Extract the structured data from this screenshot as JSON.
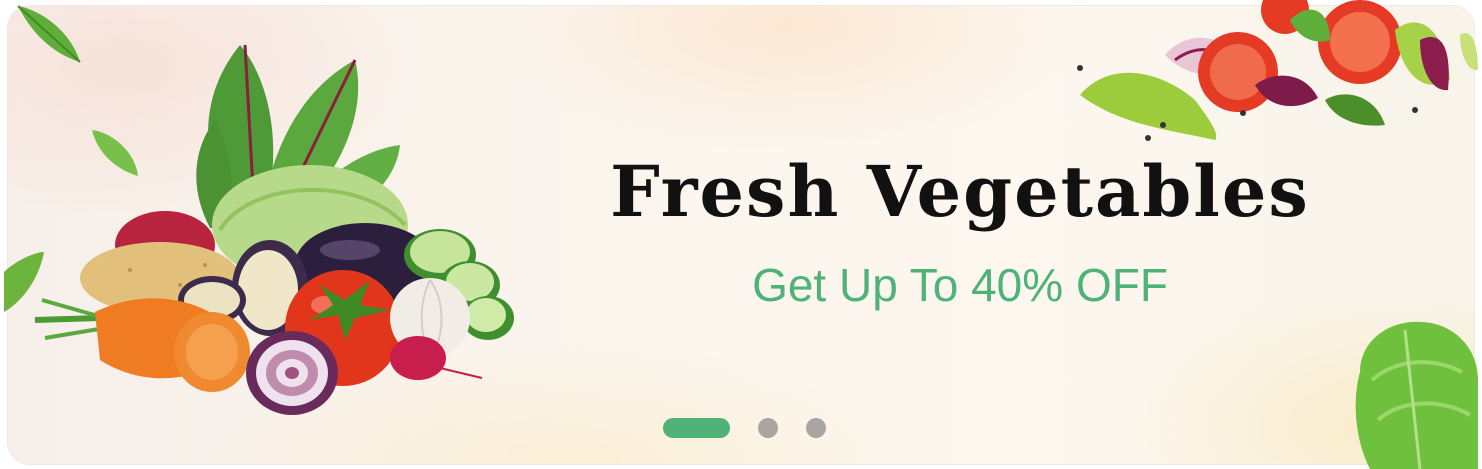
{
  "banner": {
    "headline": "Fresh Vegetables",
    "subline": "Get Up To 40% OFF",
    "colors": {
      "accent_green": "#4fb277",
      "headline": "#111111",
      "inactive_dot": "#a8a5a3"
    }
  },
  "carousel": {
    "slide_count": 3,
    "active_index": 0
  },
  "icons": [
    "vegetables-illustration",
    "salad-illustration",
    "lettuce-illustration",
    "leaf-icon"
  ]
}
